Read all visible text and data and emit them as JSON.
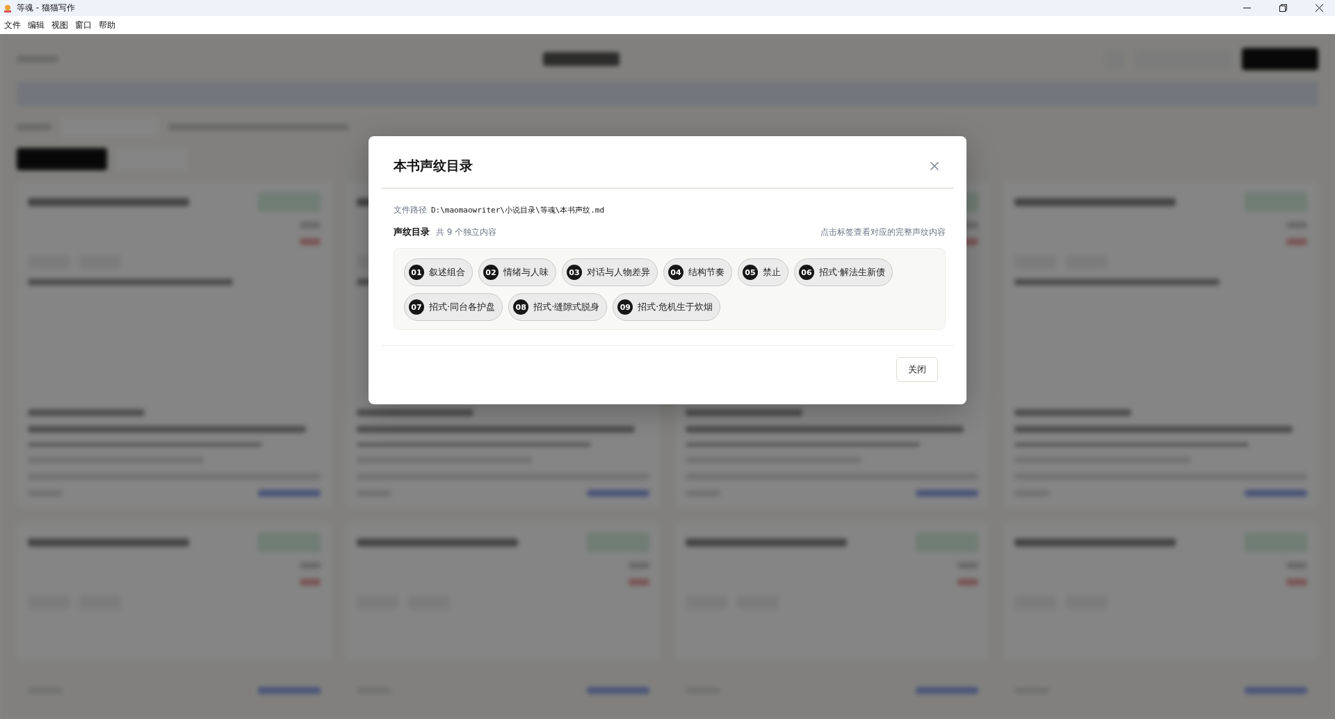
{
  "window": {
    "title": "等魂 - 猫猫写作"
  },
  "menu": [
    "文件",
    "编辑",
    "视图",
    "窗口",
    "帮助"
  ],
  "dialog": {
    "title": "本书声纹目录",
    "path_label": "文件路径",
    "path": "D:\\maomaowriter\\小说目录\\等魂\\本书声纹.md",
    "section_title": "声纹目录",
    "count": "共 9 个独立内容",
    "hint": "点击标签查看对应的完整声纹内容",
    "tags": [
      {
        "number": "01",
        "label": "叙述组合"
      },
      {
        "number": "02",
        "label": "情绪与人味"
      },
      {
        "number": "03",
        "label": "对话与人物差异"
      },
      {
        "number": "04",
        "label": "结构节奏"
      },
      {
        "number": "05",
        "label": "禁止"
      },
      {
        "number": "06",
        "label": "招式·解法生新债"
      },
      {
        "number": "07",
        "label": "招式·同台各护盘"
      },
      {
        "number": "08",
        "label": "招式·缝隙式脱身"
      },
      {
        "number": "09",
        "label": "招式·危机生于炊烟"
      }
    ],
    "close_button": "关闭"
  }
}
